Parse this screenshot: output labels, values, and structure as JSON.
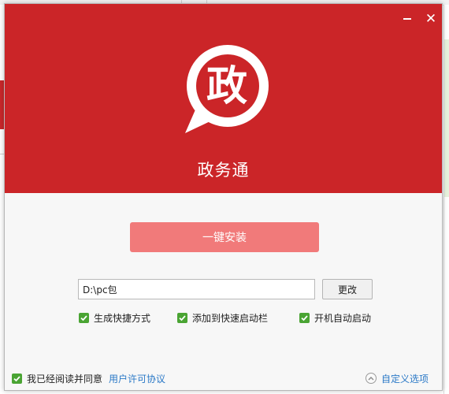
{
  "app": {
    "name": "政务通",
    "logo_char": "政"
  },
  "window_controls": {
    "minimize_icon": "minimize-icon",
    "close_glyph": "✕"
  },
  "install": {
    "button_label": "一键安装"
  },
  "path": {
    "value": "D:\\pc包",
    "change_label": "更改"
  },
  "options": [
    {
      "label": "生成快捷方式",
      "checked": true
    },
    {
      "label": "添加到快速启动栏",
      "checked": true
    },
    {
      "label": "开机自动启动",
      "checked": true
    }
  ],
  "footer": {
    "agree_label": "我已经阅读并同意",
    "agree_checked": true,
    "license_link": "用户许可协议",
    "custom_label": "自定义选项"
  },
  "colors": {
    "header_red": "#cb2528",
    "install_button": "#f17a7a",
    "check_green": "#4aa433",
    "link_blue": "#2b79c7"
  }
}
